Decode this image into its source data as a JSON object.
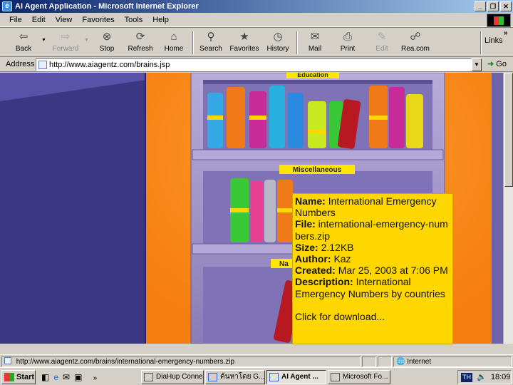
{
  "window": {
    "title": "AI Agent Application - Microsoft Internet Explorer"
  },
  "menu": [
    "File",
    "Edit",
    "View",
    "Favorites",
    "Tools",
    "Help"
  ],
  "toolbar": {
    "links_label": "Links",
    "buttons": [
      {
        "label": "Back",
        "icon": "back-arrow-icon"
      },
      {
        "label": "Forward",
        "icon": "forward-arrow-icon"
      },
      {
        "label": "Stop",
        "icon": "stop-icon"
      },
      {
        "label": "Refresh",
        "icon": "refresh-icon"
      },
      {
        "label": "Home",
        "icon": "home-icon"
      },
      {
        "label": "Search",
        "icon": "search-icon"
      },
      {
        "label": "Favorites",
        "icon": "favorites-icon"
      },
      {
        "label": "History",
        "icon": "history-icon"
      },
      {
        "label": "Mail",
        "icon": "mail-icon"
      },
      {
        "label": "Print",
        "icon": "print-icon"
      },
      {
        "label": "Edit",
        "icon": "edit-icon"
      },
      {
        "label": "Rea.com",
        "icon": "discuss-icon"
      }
    ]
  },
  "address": {
    "label": "Address",
    "url": "http://www.aiagentz.com/brains.jsp",
    "go_label": "Go"
  },
  "page": {
    "shelf_labels": [
      "Education",
      "Miscellaneous",
      "Na"
    ],
    "tooltip": {
      "name_label": "Name:",
      "name": "International Emergency Numbers",
      "file_label": "File:",
      "file": "international-emergency-numbers.zip",
      "size_label": "Size:",
      "size": "2.12KB",
      "author_label": "Author:",
      "author": "Kaz",
      "created_label": "Created:",
      "created": "Mar 25, 2003 at 7:06 PM",
      "description_label": "Description:",
      "description": "International Emergency Numbers by countries",
      "action": "Click for download..."
    }
  },
  "statusbar": {
    "url": "http://www.aiagentz.com/brains/international-emergency-numbers.zip",
    "zone": "Internet"
  },
  "taskbar": {
    "start_label": "Start",
    "tasks": [
      "DiaHup Connecti...",
      "ค้นหาโดย G...",
      "AI Agent ...",
      "Microsoft Fo..."
    ],
    "active_task": 2,
    "tray_lang": "TH",
    "clock": "18:09"
  },
  "colors": {
    "page_background": "#3a327a",
    "wall_orange": "#ff8c1a",
    "shelf_wood": "#9c8ec4",
    "tooltip_background": "#ffd700",
    "label_yellow": "#ffe600",
    "title_bar_start": "#0a246a",
    "title_bar_end": "#a6caf0"
  }
}
